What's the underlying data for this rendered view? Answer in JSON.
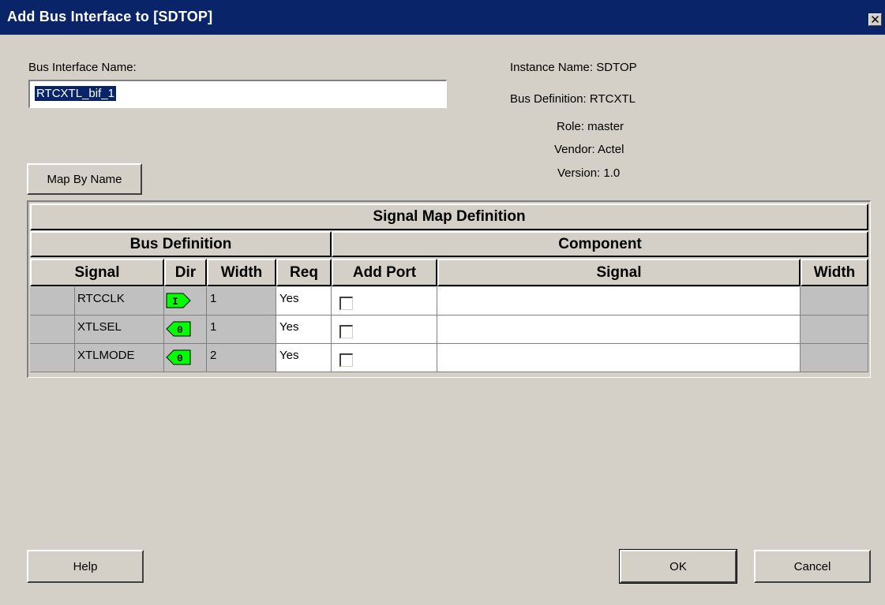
{
  "window": {
    "title": "Add Bus Interface to [SDTOP]",
    "close_glyph": "✕"
  },
  "form": {
    "bus_interface_name_label": "Bus Interface Name:",
    "bus_interface_name_value": "RTCXTL_bif_1"
  },
  "info": {
    "instance_name": "Instance Name: SDTOP",
    "bus_definition": "Bus Definition: RTCXTL",
    "role": "Role: master",
    "vendor": "Vendor: Actel",
    "version": "Version: 1.0"
  },
  "buttons": {
    "map_by_name": "Map By Name",
    "help": "Help",
    "ok": "OK",
    "cancel": "Cancel"
  },
  "grid": {
    "title": "Signal Map Definition",
    "group_bus_definition": "Bus Definition",
    "group_component": "Component",
    "columns": {
      "signal": "Signal",
      "dir": "Dir",
      "width": "Width",
      "req": "Req",
      "add_port": "Add Port",
      "comp_signal": "Signal",
      "comp_width": "Width"
    },
    "rows": [
      {
        "signal": "RTCCLK",
        "dir": "I",
        "dir_icon": "input-arrow-icon",
        "width": "1",
        "req": "Yes",
        "add_port": false,
        "comp_signal": "",
        "comp_width": ""
      },
      {
        "signal": "XTLSEL",
        "dir": "0",
        "dir_icon": "output-arrow-icon",
        "width": "1",
        "req": "Yes",
        "add_port": false,
        "comp_signal": "",
        "comp_width": ""
      },
      {
        "signal": "XTLMODE",
        "dir": "0",
        "dir_icon": "output-arrow-icon",
        "width": "2",
        "req": "Yes",
        "add_port": false,
        "comp_signal": "",
        "comp_width": ""
      }
    ]
  },
  "colors": {
    "title_bar": "#0a246a",
    "dialog_bg": "#d4d0c8",
    "dir_icon_fill": "#00ff00"
  }
}
